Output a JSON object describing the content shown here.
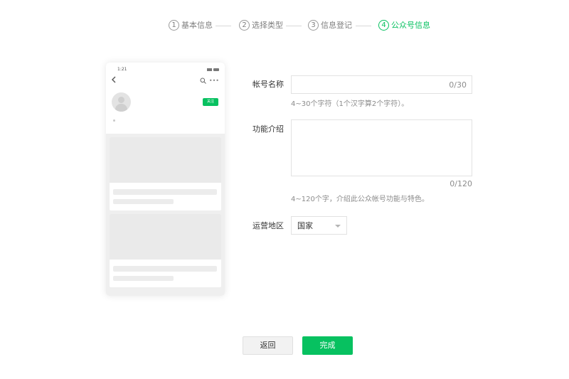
{
  "steps": [
    {
      "num": "1",
      "label": "基本信息"
    },
    {
      "num": "2",
      "label": "选择类型"
    },
    {
      "num": "3",
      "label": "信息登记"
    },
    {
      "num": "4",
      "label": "公众号信息"
    }
  ],
  "preview": {
    "time": "1:21",
    "follow_label": "关注"
  },
  "form": {
    "name_label": "帐号名称",
    "name_value": "",
    "name_counter": "0/30",
    "name_hint": "4~30个字符（1个汉字算2个字符）。",
    "intro_label": "功能介绍",
    "intro_value": "",
    "intro_counter": "0/120",
    "intro_hint": "4~120个字，介绍此公众帐号功能与特色。",
    "region_label": "运营地区",
    "region_value": "国家"
  },
  "buttons": {
    "back": "返回",
    "done": "完成"
  },
  "colors": {
    "accent": "#07c160"
  }
}
